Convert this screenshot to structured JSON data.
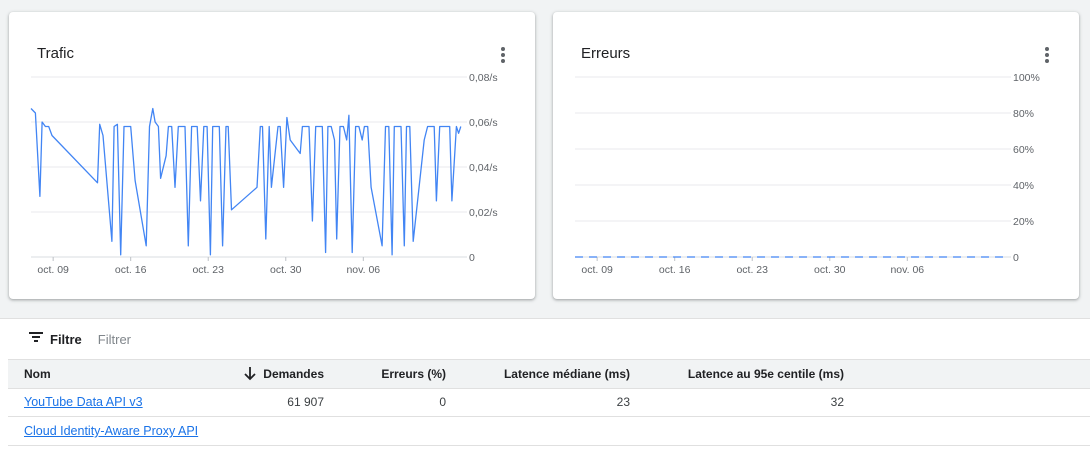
{
  "cards": [
    {
      "title": "Trafic",
      "chart_data": {
        "type": "line",
        "x_ticks": [
          "oct. 09",
          "oct. 16",
          "oct. 23",
          "oct. 30",
          "nov. 06"
        ],
        "y_ticks": [
          "0",
          "0,02/s",
          "0,04/s",
          "0,06/s",
          "0,08/s"
        ],
        "ylim": [
          0,
          0.08
        ],
        "grid": true,
        "series": [
          {
            "color": "#4285f4",
            "points": [
              [
                0.0,
                0.066
              ],
              [
                0.4,
                0.064
              ],
              [
                0.8,
                0.027
              ],
              [
                1.0,
                0.06
              ],
              [
                1.3,
                0.058
              ],
              [
                1.6,
                0.058
              ],
              [
                1.9,
                0.054
              ],
              [
                6.0,
                0.033
              ],
              [
                6.2,
                0.059
              ],
              [
                6.5,
                0.054
              ],
              [
                7.3,
                0.007
              ],
              [
                7.5,
                0.058
              ],
              [
                7.8,
                0.059
              ],
              [
                8.1,
                0.001
              ],
              [
                8.4,
                0.058
              ],
              [
                8.7,
                0.058
              ],
              [
                9.0,
                0.058
              ],
              [
                9.4,
                0.034
              ],
              [
                10.4,
                0.005
              ],
              [
                10.7,
                0.058
              ],
              [
                11.0,
                0.066
              ],
              [
                11.2,
                0.06
              ],
              [
                11.5,
                0.058
              ],
              [
                11.7,
                0.035
              ],
              [
                12.2,
                0.045
              ],
              [
                12.4,
                0.058
              ],
              [
                12.7,
                0.058
              ],
              [
                13.0,
                0.031
              ],
              [
                13.3,
                0.058
              ],
              [
                13.6,
                0.058
              ],
              [
                13.9,
                0.058
              ],
              [
                14.2,
                0.005
              ],
              [
                14.5,
                0.058
              ],
              [
                14.8,
                0.058
              ],
              [
                15.0,
                0.058
              ],
              [
                15.3,
                0.025
              ],
              [
                15.6,
                0.058
              ],
              [
                15.9,
                0.058
              ],
              [
                16.2,
                0.001
              ],
              [
                16.4,
                0.058
              ],
              [
                16.7,
                0.058
              ],
              [
                17.0,
                0.058
              ],
              [
                17.3,
                0.005
              ],
              [
                17.6,
                0.058
              ],
              [
                17.8,
                0.058
              ],
              [
                18.1,
                0.021
              ],
              [
                20.4,
                0.031
              ],
              [
                20.7,
                0.058
              ],
              [
                20.9,
                0.058
              ],
              [
                21.2,
                0.008
              ],
              [
                21.5,
                0.058
              ],
              [
                21.7,
                0.031
              ],
              [
                22.3,
                0.058
              ],
              [
                22.5,
                0.058
              ],
              [
                22.8,
                0.031
              ],
              [
                23.1,
                0.062
              ],
              [
                23.4,
                0.052
              ],
              [
                24.3,
                0.046
              ],
              [
                24.5,
                0.058
              ],
              [
                24.8,
                0.058
              ],
              [
                25.1,
                0.058
              ],
              [
                25.4,
                0.016
              ],
              [
                25.7,
                0.058
              ],
              [
                26.0,
                0.058
              ],
              [
                26.3,
                0.058
              ],
              [
                26.6,
                0.002
              ],
              [
                26.8,
                0.058
              ],
              [
                27.1,
                0.058
              ],
              [
                27.4,
                0.052
              ],
              [
                27.6,
                0.008
              ],
              [
                27.9,
                0.058
              ],
              [
                28.2,
                0.058
              ],
              [
                28.5,
                0.052
              ],
              [
                28.7,
                0.063
              ],
              [
                29.0,
                0.002
              ],
              [
                29.3,
                0.058
              ],
              [
                29.6,
                0.058
              ],
              [
                29.9,
                0.052
              ],
              [
                30.1,
                0.058
              ],
              [
                30.4,
                0.058
              ],
              [
                30.7,
                0.031
              ],
              [
                31.7,
                0.005
              ],
              [
                32.0,
                0.058
              ],
              [
                32.3,
                0.058
              ],
              [
                32.6,
                0.001
              ],
              [
                32.8,
                0.058
              ],
              [
                33.1,
                0.058
              ],
              [
                33.4,
                0.058
              ],
              [
                33.7,
                0.005
              ],
              [
                33.9,
                0.058
              ],
              [
                34.2,
                0.058
              ],
              [
                34.5,
                0.007
              ],
              [
                35.5,
                0.052
              ],
              [
                35.8,
                0.058
              ],
              [
                36.1,
                0.058
              ],
              [
                36.4,
                0.058
              ],
              [
                36.6,
                0.025
              ],
              [
                36.9,
                0.058
              ],
              [
                37.2,
                0.058
              ],
              [
                37.5,
                0.058
              ],
              [
                37.8,
                0.058
              ],
              [
                38.0,
                0.025
              ],
              [
                38.4,
                0.058
              ],
              [
                38.6,
                0.055
              ],
              [
                38.8,
                0.058
              ]
            ]
          }
        ]
      }
    },
    {
      "title": "Erreurs",
      "chart_data": {
        "type": "line",
        "x_ticks": [
          "oct. 09",
          "oct. 16",
          "oct. 23",
          "oct. 30",
          "nov. 06"
        ],
        "y_ticks": [
          "0",
          "20%",
          "40%",
          "60%",
          "80%",
          "100%"
        ],
        "ylim": [
          0,
          100
        ],
        "grid": true,
        "series": [
          {
            "color": "#4285f4",
            "style": "dashed",
            "points": [
              [
                0.0,
                0
              ],
              [
                1.5,
                0
              ],
              [
                6.0,
                0
              ],
              [
                18.1,
                0
              ],
              [
                20.4,
                0
              ],
              [
                23.4,
                0
              ],
              [
                24.3,
                0
              ],
              [
                30.7,
                0
              ],
              [
                31.7,
                0
              ],
              [
                34.5,
                0
              ],
              [
                35.5,
                0
              ],
              [
                38.8,
                0
              ]
            ]
          }
        ]
      }
    }
  ],
  "filter": {
    "label": "Filtre",
    "placeholder": "Filtrer"
  },
  "table": {
    "headers": {
      "name": "Nom",
      "requests": "Demandes",
      "errors": "Erreurs (%)",
      "median_latency": "Latence médiane (ms)",
      "p95_latency": "Latence au 95e centile (ms)"
    },
    "rows": [
      {
        "name": "YouTube Data API v3",
        "requests": "61 907",
        "errors": "0",
        "median_latency": "23",
        "p95_latency": "32"
      },
      {
        "name": "Cloud Identity-Aware Proxy API",
        "requests": "",
        "errors": "",
        "median_latency": "",
        "p95_latency": ""
      }
    ]
  }
}
